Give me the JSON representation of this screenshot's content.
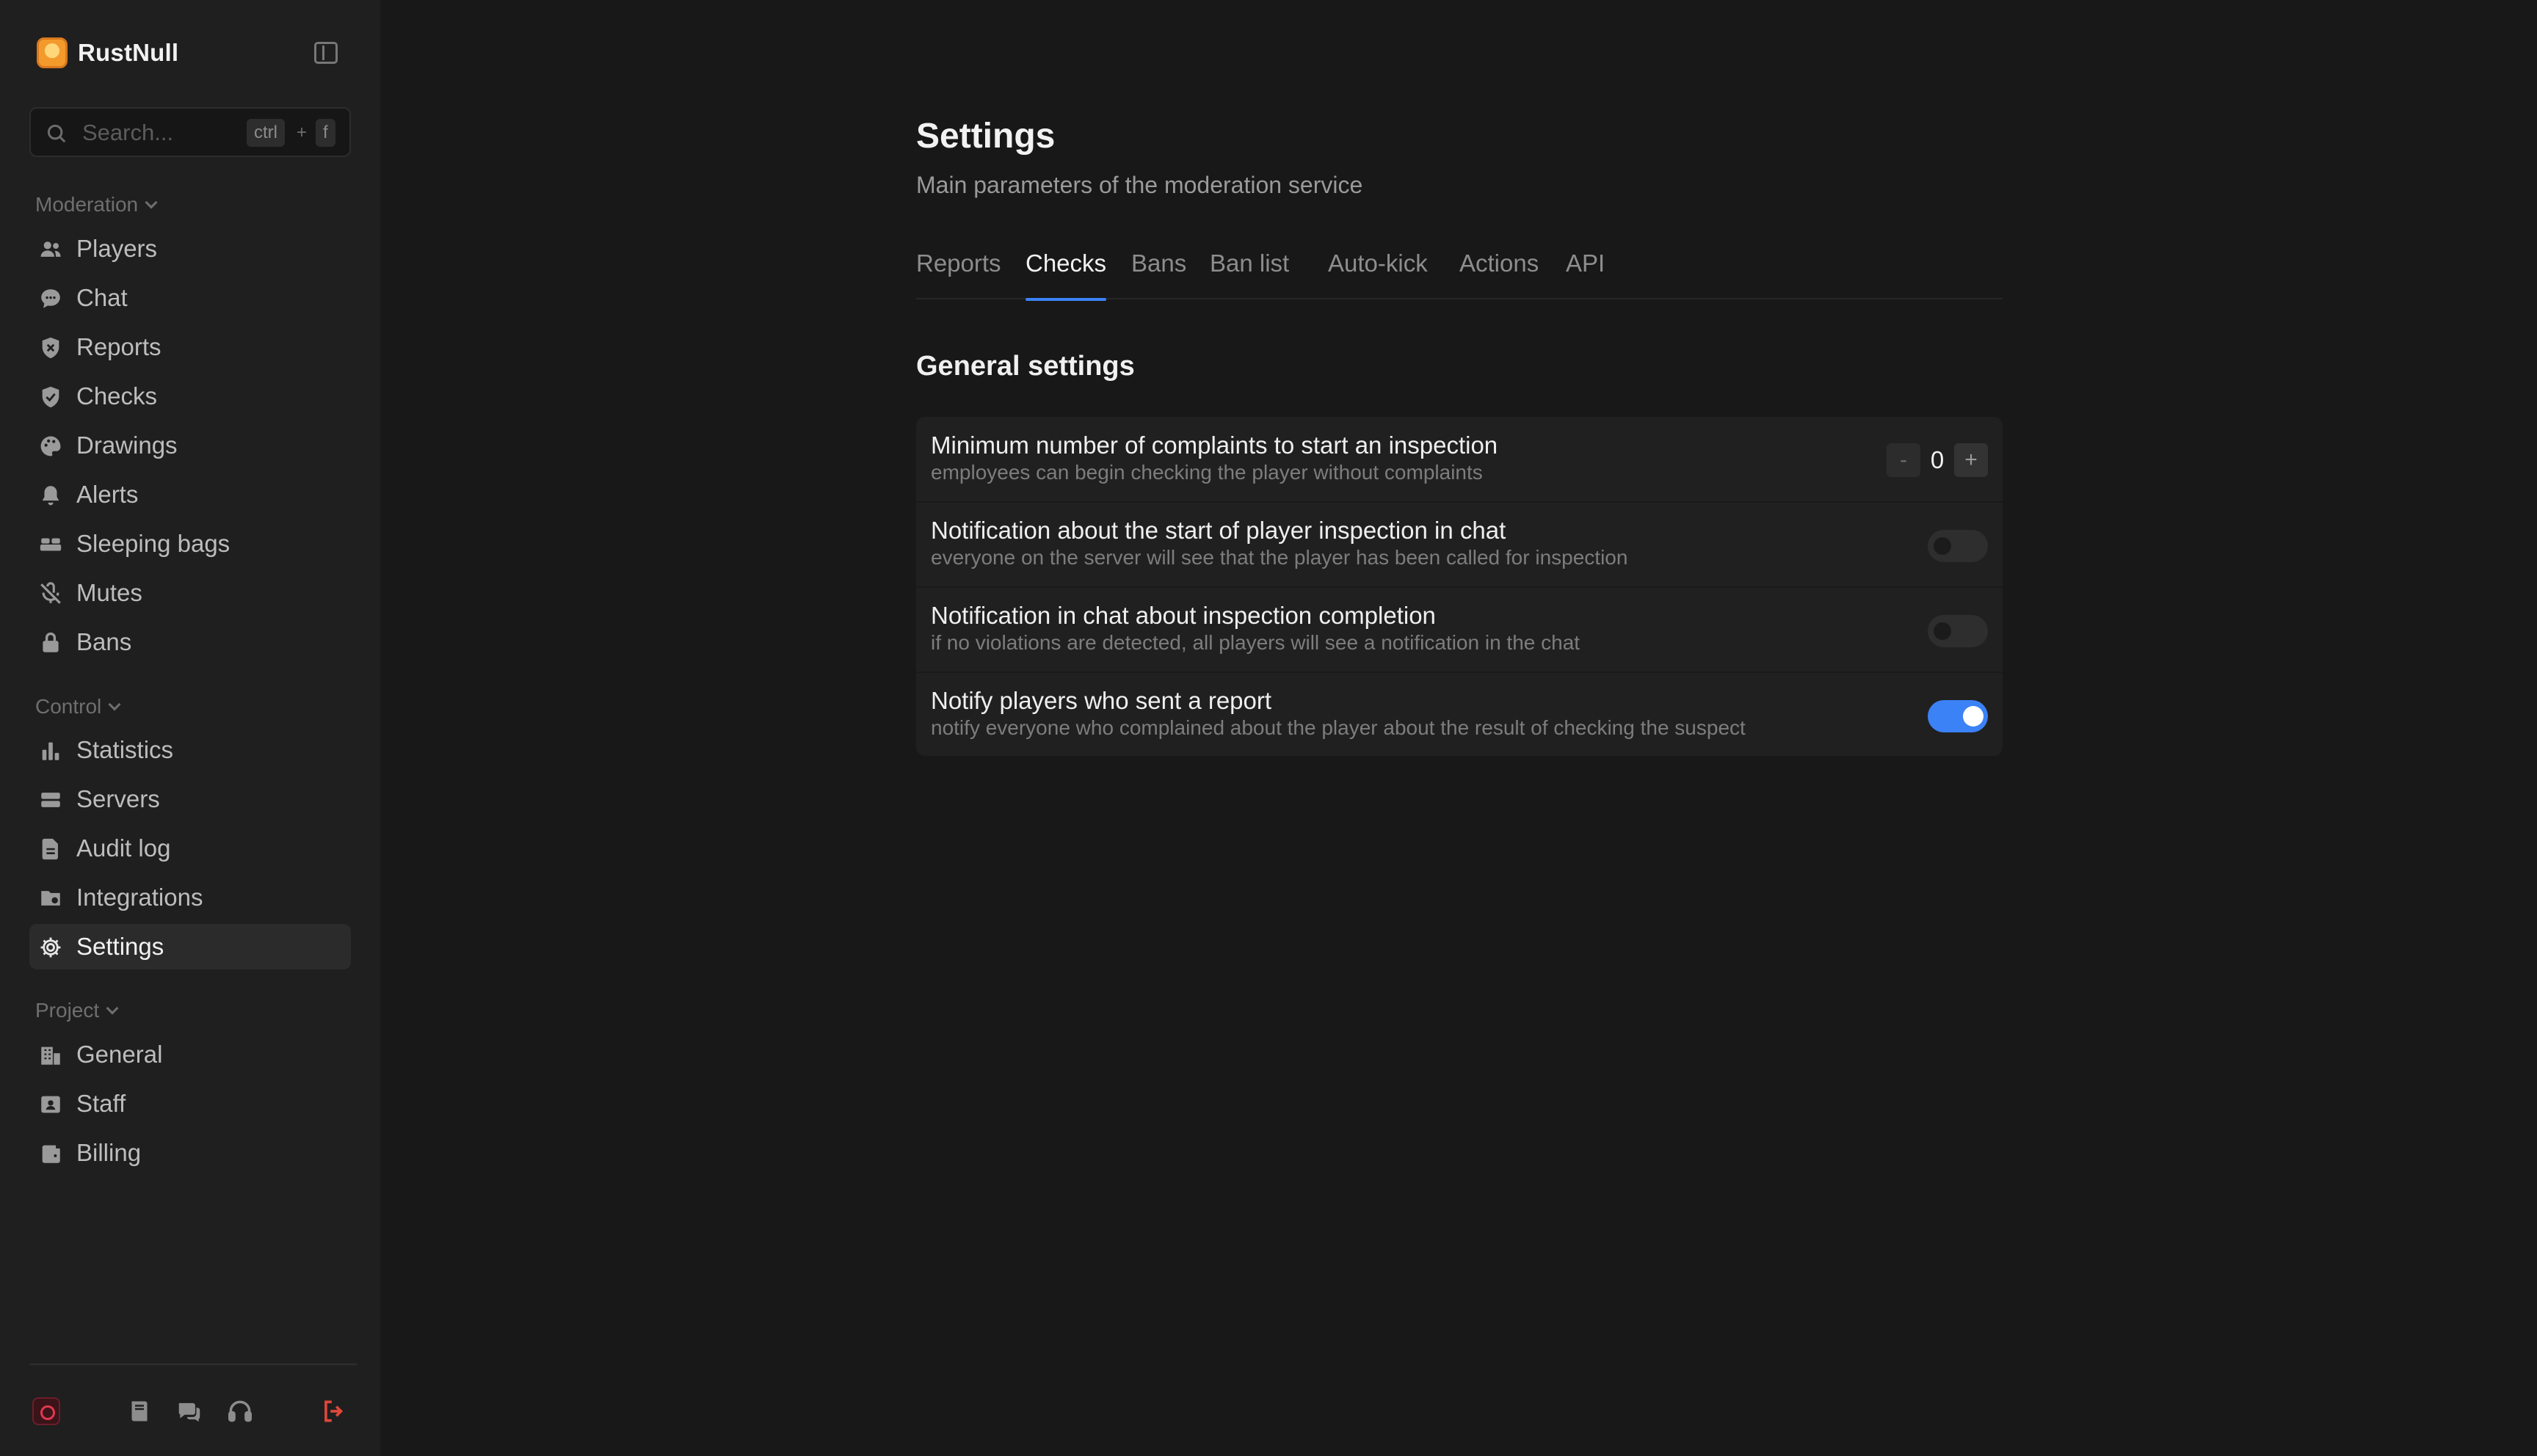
{
  "app": {
    "name": "RustNull"
  },
  "search": {
    "placeholder": "Search...",
    "shortcut_key1": "ctrl",
    "shortcut_plus": "+",
    "shortcut_key2": "f"
  },
  "sidebar": {
    "sections": [
      {
        "label": "Moderation",
        "items": [
          {
            "label": "Players",
            "icon": "users-icon"
          },
          {
            "label": "Chat",
            "icon": "chat-bubble-icon"
          },
          {
            "label": "Reports",
            "icon": "shield-x-icon"
          },
          {
            "label": "Checks",
            "icon": "shield-check-icon"
          },
          {
            "label": "Drawings",
            "icon": "palette-icon"
          },
          {
            "label": "Alerts",
            "icon": "bell-icon"
          },
          {
            "label": "Sleeping bags",
            "icon": "bed-icon"
          },
          {
            "label": "Mutes",
            "icon": "mic-off-icon"
          },
          {
            "label": "Bans",
            "icon": "lock-icon"
          }
        ]
      },
      {
        "label": "Control",
        "items": [
          {
            "label": "Statistics",
            "icon": "bar-chart-icon"
          },
          {
            "label": "Servers",
            "icon": "server-icon"
          },
          {
            "label": "Audit log",
            "icon": "document-icon"
          },
          {
            "label": "Integrations",
            "icon": "folder-plug-icon"
          },
          {
            "label": "Settings",
            "icon": "gear-icon",
            "active": true
          }
        ]
      },
      {
        "label": "Project",
        "items": [
          {
            "label": "General",
            "icon": "building-icon"
          },
          {
            "label": "Staff",
            "icon": "id-card-icon"
          },
          {
            "label": "Billing",
            "icon": "wallet-icon"
          }
        ]
      }
    ],
    "footer_icons": [
      "avatar-icon",
      "book-icon",
      "chat-bubbles-icon",
      "headset-icon",
      "logout-icon"
    ]
  },
  "page": {
    "title": "Settings",
    "subtitle": "Main parameters of the moderation service",
    "tabs": [
      "Reports",
      "Checks",
      "Bans",
      "Ban list",
      "Auto-kick",
      "Actions",
      "API"
    ],
    "active_tab": "Checks",
    "section_title": "General settings",
    "settings": [
      {
        "title": "Minimum number of complaints to start an inspection",
        "description": "employees can begin checking the player without complaints",
        "control": "stepper",
        "value": "0",
        "minus": "-",
        "plus": "+"
      },
      {
        "title": "Notification about the start of player inspection in chat",
        "description": "everyone on the server will see that the player has been called for inspection",
        "control": "toggle",
        "enabled": false
      },
      {
        "title": "Notification in chat about inspection completion",
        "description": "if no violations are detected, all players will see a notification in the chat",
        "control": "toggle",
        "enabled": false
      },
      {
        "title": "Notify players who sent a report",
        "description": "notify everyone who complained about the player about the result of checking the suspect",
        "control": "toggle",
        "enabled": true
      }
    ]
  },
  "colors": {
    "accent": "#3b82f6",
    "logout": "#e0473a",
    "brand": "#f39a2d"
  }
}
